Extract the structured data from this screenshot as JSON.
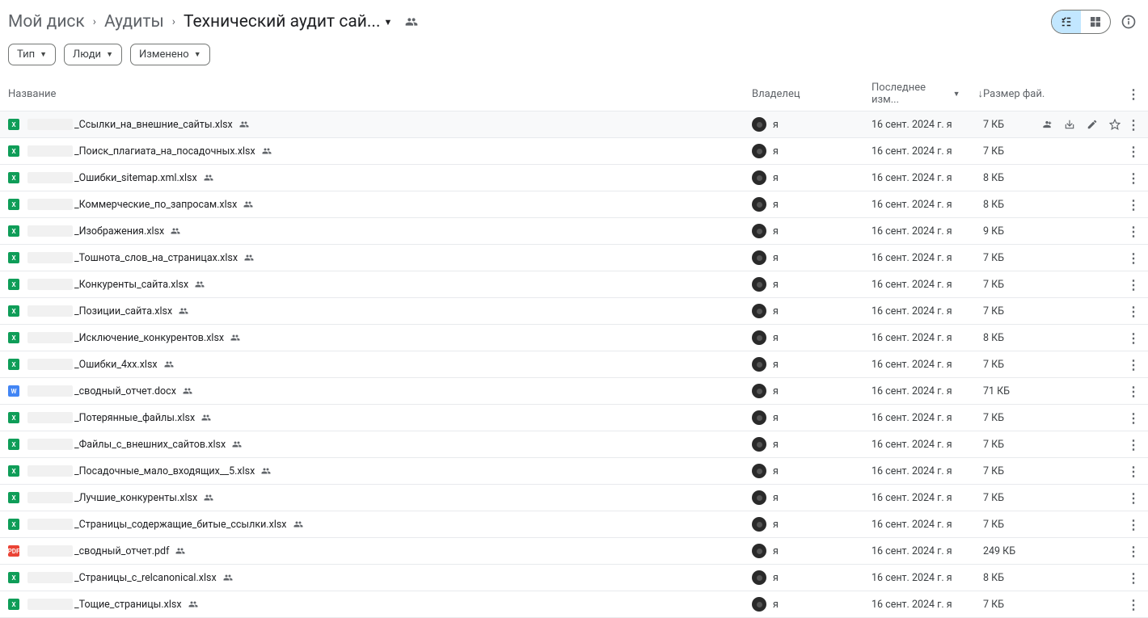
{
  "breadcrumb": {
    "items": [
      "Мой диск",
      "Аудиты",
      "Технический аудит сай..."
    ]
  },
  "filters": {
    "type": "Тип",
    "people": "Люди",
    "modified": "Изменено"
  },
  "columns": {
    "name": "Название",
    "owner": "Владелец",
    "modified": "Последнее изм...",
    "size": "Размер фай."
  },
  "owner_label": "я",
  "files": [
    {
      "icon": "xlsx",
      "name": "_Ссылки_на_внешние_сайты.xlsx",
      "date": "16 сент. 2024 г. я",
      "size": "7 КБ",
      "selected": true
    },
    {
      "icon": "xlsx",
      "name": "_Поиск_плагиата_на_посадочных.xlsx",
      "date": "16 сент. 2024 г. я",
      "size": "7 КБ"
    },
    {
      "icon": "xlsx",
      "name": "_Ошибки_sitemap.xml.xlsx",
      "date": "16 сент. 2024 г. я",
      "size": "8 КБ"
    },
    {
      "icon": "xlsx",
      "name": "_Коммерческие_по_запросам.xlsx",
      "date": "16 сент. 2024 г. я",
      "size": "8 КБ"
    },
    {
      "icon": "xlsx",
      "name": "_Изображения.xlsx",
      "date": "16 сент. 2024 г. я",
      "size": "9 КБ"
    },
    {
      "icon": "xlsx",
      "name": "_Тошнота_слов_на_страницах.xlsx",
      "date": "16 сент. 2024 г. я",
      "size": "7 КБ"
    },
    {
      "icon": "xlsx",
      "name": "_Конкуренты_сайта.xlsx",
      "date": "16 сент. 2024 г. я",
      "size": "7 КБ"
    },
    {
      "icon": "xlsx",
      "name": "_Позиции_сайта.xlsx",
      "date": "16 сент. 2024 г. я",
      "size": "7 КБ"
    },
    {
      "icon": "xlsx",
      "name": "_Исключение_конкурентов.xlsx",
      "date": "16 сент. 2024 г. я",
      "size": "8 КБ"
    },
    {
      "icon": "xlsx",
      "name": "_Ошибки_4xx.xlsx",
      "date": "16 сент. 2024 г. я",
      "size": "7 КБ"
    },
    {
      "icon": "docx",
      "name": "_сводный_отчет.docx",
      "date": "16 сент. 2024 г. я",
      "size": "71 КБ"
    },
    {
      "icon": "xlsx",
      "name": "_Потерянные_файлы.xlsx",
      "date": "16 сент. 2024 г. я",
      "size": "7 КБ"
    },
    {
      "icon": "xlsx",
      "name": "_Файлы_с_внешних_сайтов.xlsx",
      "date": "16 сент. 2024 г. я",
      "size": "7 КБ"
    },
    {
      "icon": "xlsx",
      "name": "_Посадочные_мало_входящих__5.xlsx",
      "date": "16 сент. 2024 г. я",
      "size": "7 КБ"
    },
    {
      "icon": "xlsx",
      "name": "_Лучшие_конкуренты.xlsx",
      "date": "16 сент. 2024 г. я",
      "size": "7 КБ"
    },
    {
      "icon": "xlsx",
      "name": "_Страницы_содержащие_битые_ссылки.xlsx",
      "date": "16 сент. 2024 г. я",
      "size": "7 КБ"
    },
    {
      "icon": "pdf",
      "name": "_сводный_отчет.pdf",
      "date": "16 сент. 2024 г. я",
      "size": "249 КБ"
    },
    {
      "icon": "xlsx",
      "name": "_Страницы_с_relcanonical.xlsx",
      "date": "16 сент. 2024 г. я",
      "size": "8 КБ"
    },
    {
      "icon": "xlsx",
      "name": "_Тощие_страницы.xlsx",
      "date": "16 сент. 2024 г. я",
      "size": "7 КБ"
    }
  ],
  "icon_text": {
    "xlsx": "X",
    "docx": "W",
    "pdf": "PDF"
  }
}
